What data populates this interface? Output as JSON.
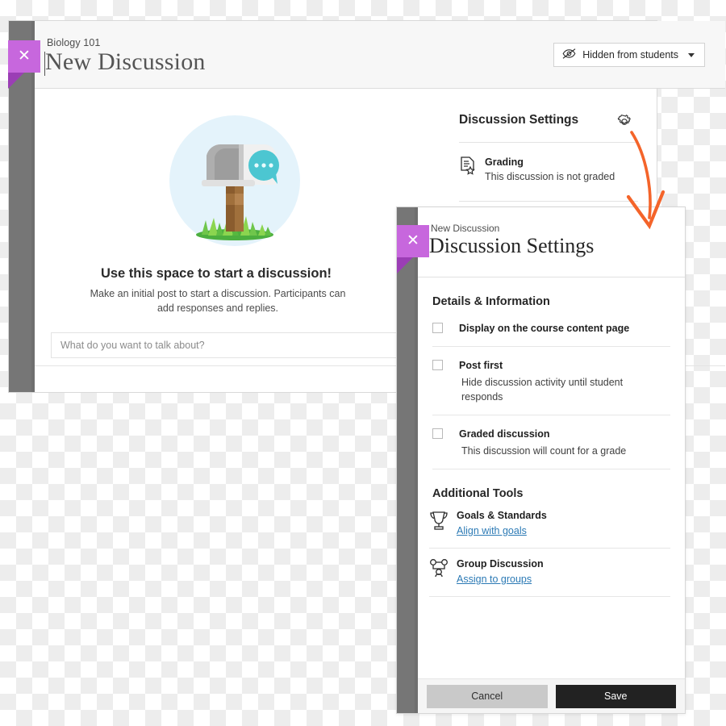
{
  "back_window": {
    "breadcrumb": "Biology 101",
    "title": "New Discussion",
    "close_icon": "close-x-icon",
    "visibility": {
      "icon": "eye-slash-icon",
      "label": "Hidden from students",
      "caret": "chevron-down-icon"
    },
    "empty_state": {
      "illustration": "mailbox-illustration",
      "heading": "Use this space to start a discussion!",
      "description": "Make an initial post to start a discussion. Participants can add responses and replies.",
      "input_placeholder": "What do you want to talk about?",
      "input_value": ""
    },
    "settings_panel": {
      "title": "Discussion Settings",
      "gear_icon": "gear-icon",
      "rows": [
        {
          "icon": "grading-document-star-icon",
          "label": "Grading",
          "sub": "This discussion is not graded"
        }
      ]
    }
  },
  "annotation": {
    "arrow_icon": "curved-arrow-icon",
    "color": "#f4642a"
  },
  "modal": {
    "breadcrumb": "New Discussion",
    "title": "Discussion Settings",
    "close_icon": "close-x-icon",
    "sections": [
      {
        "heading": "Details & Information",
        "options": [
          {
            "label": "Display on the course content page",
            "desc": "",
            "checked": false
          },
          {
            "label": "Post first",
            "desc": "Hide discussion activity until student responds",
            "checked": false
          },
          {
            "label": "Graded discussion",
            "desc": "This discussion will count for a grade",
            "checked": false
          }
        ]
      }
    ],
    "tools_heading": "Additional Tools",
    "tools": [
      {
        "icon": "trophy-icon",
        "label": "Goals & Standards",
        "link": "Align with goals"
      },
      {
        "icon": "group-people-icon",
        "label": "Group Discussion",
        "link": "Assign to groups"
      }
    ],
    "footer": {
      "cancel_label": "Cancel",
      "save_label": "Save"
    }
  },
  "colors": {
    "accent_purple": "#c767dd",
    "accent_purple_dark": "#9b3eb5",
    "rail_gray": "#767676",
    "link_blue": "#2c7ab5",
    "annotation_orange": "#f4642a",
    "save_black": "#222222",
    "cancel_gray": "#c9c9c9"
  }
}
